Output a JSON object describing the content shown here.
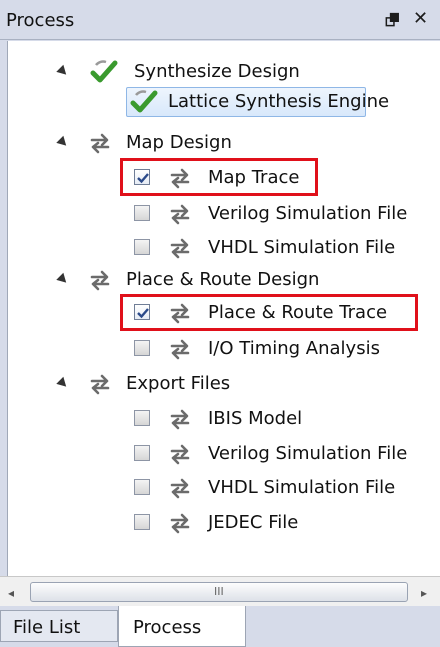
{
  "panel": {
    "title": "Process",
    "float_icon": "restore-window-icon",
    "close_icon": "close-icon",
    "float_glyph": "⮻",
    "close_glyph": "✕"
  },
  "tree": {
    "synthesize": {
      "label": "Synthesize Design",
      "icon": "green-check-icon"
    },
    "lattice": {
      "label": "Lattice Synthesis Engine",
      "icon": "green-check-icon"
    },
    "map_design": {
      "label": "Map Design",
      "icon": "sync-arrows-icon"
    },
    "map_trace": {
      "label": "Map Trace",
      "checked": true
    },
    "map_verilog": {
      "label": "Verilog Simulation File",
      "checked": false
    },
    "map_vhdl": {
      "label": "VHDL Simulation File",
      "checked": false
    },
    "par_design": {
      "label": "Place & Route Design",
      "icon": "sync-arrows-icon"
    },
    "par_trace": {
      "label": "Place & Route Trace",
      "checked": true
    },
    "io_timing": {
      "label": "I/O Timing Analysis",
      "checked": false
    },
    "export": {
      "label": "Export Files",
      "icon": "sync-arrows-icon"
    },
    "ibis": {
      "label": "IBIS Model",
      "checked": false
    },
    "exp_verilog": {
      "label": "Verilog Simulation File",
      "checked": false
    },
    "exp_vhdl": {
      "label": "VHDL Simulation File",
      "checked": false
    },
    "jedec": {
      "label": "JEDEC File",
      "checked": false
    }
  },
  "scrollbar": {
    "left_arrow": "◂",
    "right_arrow": "▸",
    "grip": "III"
  },
  "tabs": {
    "file_list": "File List",
    "process": "Process"
  },
  "colors": {
    "highlight": "#e0101a",
    "check_green": "#3a9a2e",
    "sync_gray": "#6b6b6b"
  }
}
